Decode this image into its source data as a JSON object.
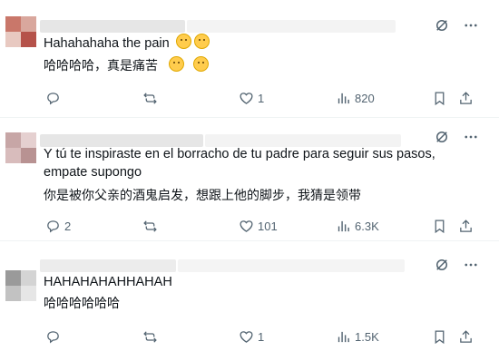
{
  "posts": [
    {
      "text": "Hahahahaha the pain",
      "translation": "哈哈哈哈，真是痛苦",
      "emoji": "grin-sweat-emoji",
      "stats": {
        "replies": "",
        "reposts": "",
        "likes": "1",
        "views": "820"
      }
    },
    {
      "text": "Y tú te inspiraste en el borracho de tu padre para seguir sus pasos, empate supongo",
      "translation": "你是被你父亲的酒鬼启发，想跟上他的脚步，我猜是领带",
      "stats": {
        "replies": "2",
        "reposts": "",
        "likes": "101",
        "views": "6.3K"
      }
    },
    {
      "text": "HAHAHAHAHHAHAH",
      "translation": "哈哈哈哈哈哈",
      "stats": {
        "replies": "",
        "reposts": "",
        "likes": "1",
        "views": "1.5K"
      }
    }
  ],
  "colors": {
    "text": "#0f1419",
    "muted": "#536471",
    "divider": "#eff3f4"
  }
}
